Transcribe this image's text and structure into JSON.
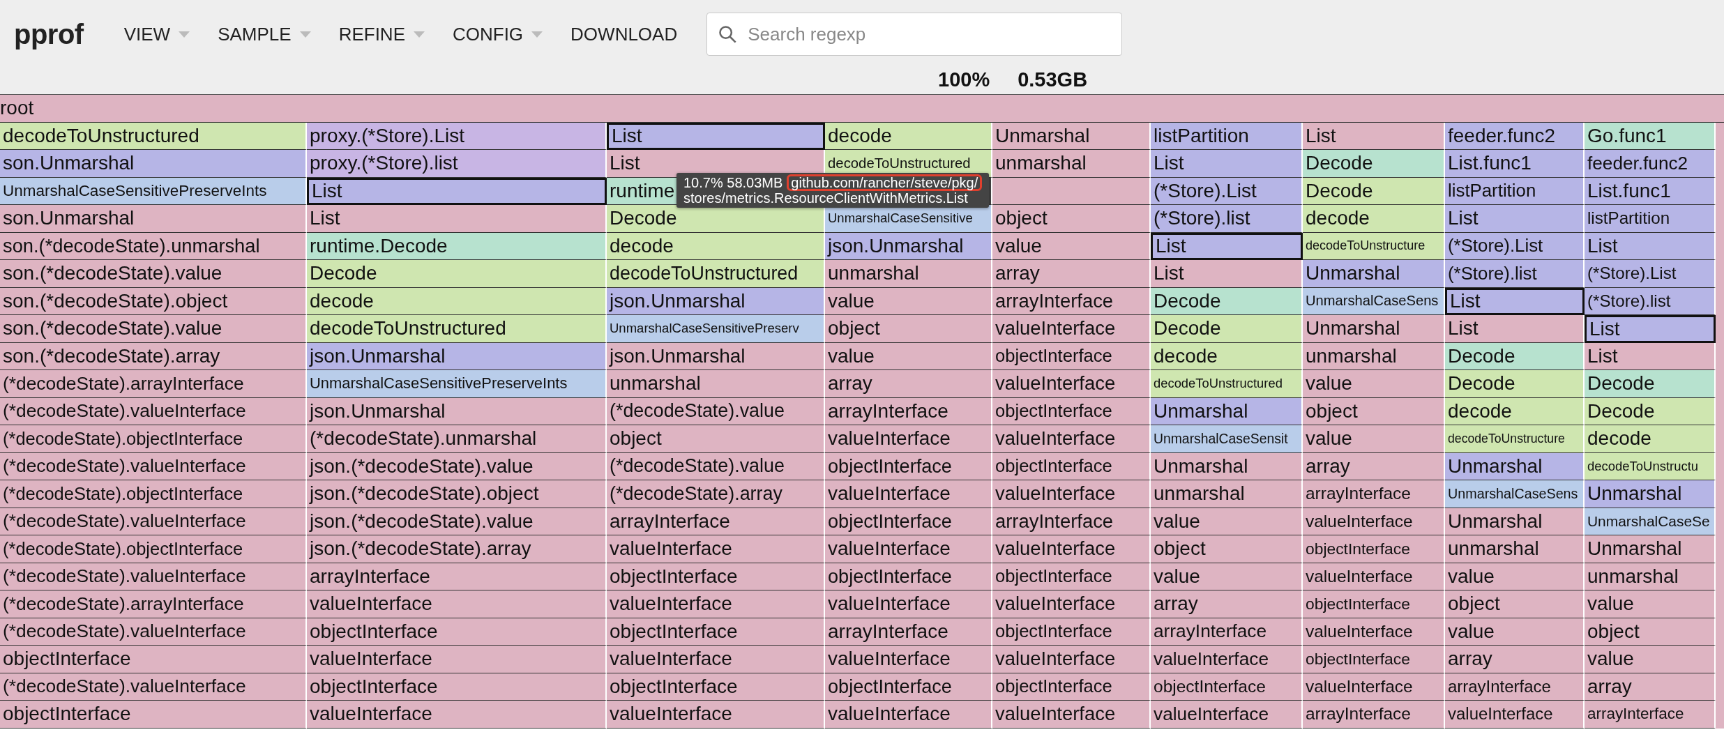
{
  "header": {
    "logo": "pprof",
    "menus": [
      {
        "label": "VIEW",
        "dropdown": true
      },
      {
        "label": "SAMPLE",
        "dropdown": true
      },
      {
        "label": "REFINE",
        "dropdown": true
      },
      {
        "label": "CONFIG",
        "dropdown": true
      },
      {
        "label": "DOWNLOAD",
        "dropdown": false
      }
    ],
    "search": {
      "placeholder": "Search regexp"
    },
    "stats": [
      "100%",
      "0.53GB"
    ]
  },
  "flame": {
    "root": {
      "name": "root",
      "color": "#deb4c2"
    },
    "columns": [
      {
        "frames": [
          {
            "name": "decodeToUnstructured",
            "color": "#cfe6b0",
            "highlighted": false
          },
          {
            "name": "son.Unmarshal",
            "color": "#b6b5e6",
            "highlighted": false
          },
          {
            "name": "UnmarshalCaseSensitivePreserveInts",
            "color": "#b9cdea",
            "highlighted": false
          },
          {
            "name": "son.Unmarshal",
            "color": "#deb4c2",
            "highlighted": false
          },
          {
            "name": "son.(*decodeState).unmarshal",
            "color": "#deb4c2",
            "highlighted": false
          },
          {
            "name": "son.(*decodeState).value",
            "color": "#deb4c2",
            "highlighted": false
          },
          {
            "name": "son.(*decodeState).object",
            "color": "#deb4c2",
            "highlighted": false
          },
          {
            "name": "son.(*decodeState).value",
            "color": "#deb4c2",
            "highlighted": false
          },
          {
            "name": "son.(*decodeState).array",
            "color": "#deb4c2",
            "highlighted": false
          },
          {
            "name": "(*decodeState).arrayInterface",
            "color": "#deb4c2",
            "highlighted": false
          },
          {
            "name": "(*decodeState).valueInterface",
            "color": "#deb4c2",
            "highlighted": false
          },
          {
            "name": "(*decodeState).objectInterface",
            "color": "#deb4c2",
            "highlighted": false
          },
          {
            "name": "(*decodeState).valueInterface",
            "color": "#deb4c2",
            "highlighted": false
          },
          {
            "name": "(*decodeState).objectInterface",
            "color": "#deb4c2",
            "highlighted": false
          },
          {
            "name": "(*decodeState).valueInterface",
            "color": "#deb4c2",
            "highlighted": false
          },
          {
            "name": "(*decodeState).objectInterface",
            "color": "#deb4c2",
            "highlighted": false
          },
          {
            "name": "(*decodeState).valueInterface",
            "color": "#deb4c2",
            "highlighted": false
          },
          {
            "name": "(*decodeState).arrayInterface",
            "color": "#deb4c2",
            "highlighted": false
          },
          {
            "name": "(*decodeState).valueInterface",
            "color": "#deb4c2",
            "highlighted": false
          },
          {
            "name": "objectInterface",
            "color": "#deb4c2",
            "highlighted": false
          },
          {
            "name": "(*decodeState).valueInterface",
            "color": "#deb4c2",
            "highlighted": false
          },
          {
            "name": "objectInterface",
            "color": "#deb4c2",
            "highlighted": false
          }
        ]
      },
      {
        "frames": [
          {
            "name": "proxy.(*Store).List",
            "color": "#c8b5e4",
            "highlighted": false
          },
          {
            "name": "proxy.(*Store).list",
            "color": "#c8b5e4",
            "highlighted": false
          },
          {
            "name": "List",
            "color": "#b6b5e6",
            "highlighted": true
          },
          {
            "name": "List",
            "color": "#deb4c2",
            "highlighted": false
          },
          {
            "name": "runtime.Decode",
            "color": "#b7e2cf",
            "highlighted": false
          },
          {
            "name": "Decode",
            "color": "#cfe6b0",
            "highlighted": false
          },
          {
            "name": "decode",
            "color": "#cfe6b0",
            "highlighted": false
          },
          {
            "name": "decodeToUnstructured",
            "color": "#cfe6b0",
            "highlighted": false
          },
          {
            "name": "json.Unmarshal",
            "color": "#b6b5e6",
            "highlighted": false
          },
          {
            "name": "UnmarshalCaseSensitivePreserveInts",
            "color": "#b9cdea",
            "highlighted": false
          },
          {
            "name": "json.Unmarshal",
            "color": "#deb4c2",
            "highlighted": false
          },
          {
            "name": "(*decodeState).unmarshal",
            "color": "#deb4c2",
            "highlighted": false
          },
          {
            "name": "json.(*decodeState).value",
            "color": "#deb4c2",
            "highlighted": false
          },
          {
            "name": "json.(*decodeState).object",
            "color": "#deb4c2",
            "highlighted": false
          },
          {
            "name": "json.(*decodeState).value",
            "color": "#deb4c2",
            "highlighted": false
          },
          {
            "name": "json.(*decodeState).array",
            "color": "#deb4c2",
            "highlighted": false
          },
          {
            "name": "arrayInterface",
            "color": "#deb4c2",
            "highlighted": false
          },
          {
            "name": "valueInterface",
            "color": "#deb4c2",
            "highlighted": false
          },
          {
            "name": "objectInterface",
            "color": "#deb4c2",
            "highlighted": false
          },
          {
            "name": "valueInterface",
            "color": "#deb4c2",
            "highlighted": false
          },
          {
            "name": "objectInterface",
            "color": "#deb4c2",
            "highlighted": false
          },
          {
            "name": "valueInterface",
            "color": "#deb4c2",
            "highlighted": false
          }
        ]
      },
      {
        "frames": [
          {
            "name": "List",
            "color": "#b6b5e6",
            "highlighted": true
          },
          {
            "name": "List",
            "color": "#deb4c2",
            "highlighted": false
          },
          {
            "name": "runtime",
            "color": "#b7e2cf",
            "highlighted": false
          },
          {
            "name": "Decode",
            "color": "#cfe6b0",
            "highlighted": false
          },
          {
            "name": "decode",
            "color": "#cfe6b0",
            "highlighted": false
          },
          {
            "name": "decodeToUnstructured",
            "color": "#cfe6b0",
            "highlighted": false
          },
          {
            "name": "json.Unmarshal",
            "color": "#b6b5e6",
            "highlighted": false
          },
          {
            "name": "UnmarshalCaseSensitivePreserv",
            "color": "#b9cdea",
            "highlighted": false
          },
          {
            "name": "json.Unmarshal",
            "color": "#deb4c2",
            "highlighted": false
          },
          {
            "name": "unmarshal",
            "color": "#deb4c2",
            "highlighted": false
          },
          {
            "name": "(*decodeState).value",
            "color": "#deb4c2",
            "highlighted": false
          },
          {
            "name": "object",
            "color": "#deb4c2",
            "highlighted": false
          },
          {
            "name": "(*decodeState).value",
            "color": "#deb4c2",
            "highlighted": false
          },
          {
            "name": "(*decodeState).array",
            "color": "#deb4c2",
            "highlighted": false
          },
          {
            "name": "arrayInterface",
            "color": "#deb4c2",
            "highlighted": false
          },
          {
            "name": "valueInterface",
            "color": "#deb4c2",
            "highlighted": false
          },
          {
            "name": "objectInterface",
            "color": "#deb4c2",
            "highlighted": false
          },
          {
            "name": "valueInterface",
            "color": "#deb4c2",
            "highlighted": false
          },
          {
            "name": "objectInterface",
            "color": "#deb4c2",
            "highlighted": false
          },
          {
            "name": "valueInterface",
            "color": "#deb4c2",
            "highlighted": false
          },
          {
            "name": "objectInterface",
            "color": "#deb4c2",
            "highlighted": false
          },
          {
            "name": "valueInterface",
            "color": "#deb4c2",
            "highlighted": false
          }
        ]
      },
      {
        "frames": [
          {
            "name": "decode",
            "color": "#cfe6b0",
            "highlighted": false
          },
          {
            "name": "decodeToUnstructured",
            "color": "#cfe6b0",
            "highlighted": false
          },
          {
            "kind": "covered"
          },
          {
            "name": "UnmarshalCaseSensitive",
            "color": "#b9cdea",
            "highlighted": false
          },
          {
            "name": "json.Unmarshal",
            "color": "#b6b5e6",
            "highlighted": false
          },
          {
            "name": "unmarshal",
            "color": "#deb4c2",
            "highlighted": false
          },
          {
            "name": "value",
            "color": "#deb4c2",
            "highlighted": false
          },
          {
            "name": "object",
            "color": "#deb4c2",
            "highlighted": false
          },
          {
            "name": "value",
            "color": "#deb4c2",
            "highlighted": false
          },
          {
            "name": "array",
            "color": "#deb4c2",
            "highlighted": false
          },
          {
            "name": "arrayInterface",
            "color": "#deb4c2",
            "highlighted": false
          },
          {
            "name": "valueInterface",
            "color": "#deb4c2",
            "highlighted": false
          },
          {
            "name": "objectInterface",
            "color": "#deb4c2",
            "highlighted": false
          },
          {
            "name": "valueInterface",
            "color": "#deb4c2",
            "highlighted": false
          },
          {
            "name": "objectInterface",
            "color": "#deb4c2",
            "highlighted": false
          },
          {
            "name": "valueInterface",
            "color": "#deb4c2",
            "highlighted": false
          },
          {
            "name": "objectInterface",
            "color": "#deb4c2",
            "highlighted": false
          },
          {
            "name": "valueInterface",
            "color": "#deb4c2",
            "highlighted": false
          },
          {
            "name": "arrayInterface",
            "color": "#deb4c2",
            "highlighted": false
          },
          {
            "name": "valueInterface",
            "color": "#deb4c2",
            "highlighted": false
          },
          {
            "name": "objectInterface",
            "color": "#deb4c2",
            "highlighted": false
          },
          {
            "name": "valueInterface",
            "color": "#deb4c2",
            "highlighted": false
          }
        ]
      },
      {
        "frames": [
          {
            "name": "Unmarshal",
            "color": "#deb4c2",
            "highlighted": false
          },
          {
            "name": "unmarshal",
            "color": "#deb4c2",
            "highlighted": false
          },
          {
            "color": "#deb4c2",
            "highlighted": false
          },
          {
            "name": "object",
            "color": "#deb4c2",
            "highlighted": false
          },
          {
            "name": "value",
            "color": "#deb4c2",
            "highlighted": false
          },
          {
            "name": "array",
            "color": "#deb4c2",
            "highlighted": false
          },
          {
            "name": "arrayInterface",
            "color": "#deb4c2",
            "highlighted": false
          },
          {
            "name": "valueInterface",
            "color": "#deb4c2",
            "highlighted": false
          },
          {
            "name": "objectInterface",
            "color": "#deb4c2",
            "highlighted": false
          },
          {
            "name": "valueInterface",
            "color": "#deb4c2",
            "highlighted": false
          },
          {
            "name": "objectInterface",
            "color": "#deb4c2",
            "highlighted": false
          },
          {
            "name": "valueInterface",
            "color": "#deb4c2",
            "highlighted": false
          },
          {
            "name": "objectInterface",
            "color": "#deb4c2",
            "highlighted": false
          },
          {
            "name": "valueInterface",
            "color": "#deb4c2",
            "highlighted": false
          },
          {
            "name": "arrayInterface",
            "color": "#deb4c2",
            "highlighted": false
          },
          {
            "name": "valueInterface",
            "color": "#deb4c2",
            "highlighted": false
          },
          {
            "name": "objectInterface",
            "color": "#deb4c2",
            "highlighted": false
          },
          {
            "name": "valueInterface",
            "color": "#deb4c2",
            "highlighted": false
          },
          {
            "name": "objectInterface",
            "color": "#deb4c2",
            "highlighted": false
          },
          {
            "name": "valueInterface",
            "color": "#deb4c2",
            "highlighted": false
          },
          {
            "name": "objectInterface",
            "color": "#deb4c2",
            "highlighted": false
          },
          {
            "name": "valueInterface",
            "color": "#deb4c2",
            "highlighted": false
          }
        ]
      },
      {
        "frames": [
          {
            "name": "listPartition",
            "color": "#b6b5e6",
            "highlighted": false
          },
          {
            "name": "List",
            "color": "#b6b5e6",
            "highlighted": false
          },
          {
            "name": "(*Store).List",
            "color": "#b6b5e6",
            "highlighted": false
          },
          {
            "name": "(*Store).list",
            "color": "#b6b5e6",
            "highlighted": false
          },
          {
            "name": "List",
            "color": "#b6b5e6",
            "highlighted": true
          },
          {
            "name": "List",
            "color": "#deb4c2",
            "highlighted": false
          },
          {
            "name": "Decode",
            "color": "#b7e2cf",
            "highlighted": false
          },
          {
            "name": "Decode",
            "color": "#cfe6b0",
            "highlighted": false
          },
          {
            "name": "decode",
            "color": "#cfe6b0",
            "highlighted": false
          },
          {
            "name": "decodeToUnstructured",
            "color": "#cfe6b0",
            "highlighted": false
          },
          {
            "name": "Unmarshal",
            "color": "#b6b5e6",
            "highlighted": false
          },
          {
            "name": "UnmarshalCaseSensit",
            "color": "#b9cdea",
            "highlighted": false
          },
          {
            "name": "Unmarshal",
            "color": "#deb4c2",
            "highlighted": false
          },
          {
            "name": "unmarshal",
            "color": "#deb4c2",
            "highlighted": false
          },
          {
            "name": "value",
            "color": "#deb4c2",
            "highlighted": false
          },
          {
            "name": "object",
            "color": "#deb4c2",
            "highlighted": false
          },
          {
            "name": "value",
            "color": "#deb4c2",
            "highlighted": false
          },
          {
            "name": "array",
            "color": "#deb4c2",
            "highlighted": false
          },
          {
            "name": "arrayInterface",
            "color": "#deb4c2",
            "highlighted": false
          },
          {
            "name": "valueInterface",
            "color": "#deb4c2",
            "highlighted": false
          },
          {
            "name": "objectInterface",
            "color": "#deb4c2",
            "highlighted": false
          },
          {
            "name": "valueInterface",
            "color": "#deb4c2",
            "highlighted": false
          }
        ]
      },
      {
        "frames": [
          {
            "name": "List",
            "color": "#deb4c2",
            "highlighted": false
          },
          {
            "name": "Decode",
            "color": "#b7e2cf",
            "highlighted": false
          },
          {
            "name": "Decode",
            "color": "#cfe6b0",
            "highlighted": false
          },
          {
            "name": "decode",
            "color": "#cfe6b0",
            "highlighted": false
          },
          {
            "name": "decodeToUnstructure",
            "color": "#cfe6b0",
            "highlighted": false
          },
          {
            "name": "Unmarshal",
            "color": "#b6b5e6",
            "highlighted": false
          },
          {
            "name": "UnmarshalCaseSens",
            "color": "#b9cdea",
            "highlighted": false
          },
          {
            "name": "Unmarshal",
            "color": "#deb4c2",
            "highlighted": false
          },
          {
            "name": "unmarshal",
            "color": "#deb4c2",
            "highlighted": false
          },
          {
            "name": "value",
            "color": "#deb4c2",
            "highlighted": false
          },
          {
            "name": "object",
            "color": "#deb4c2",
            "highlighted": false
          },
          {
            "name": "value",
            "color": "#deb4c2",
            "highlighted": false
          },
          {
            "name": "array",
            "color": "#deb4c2",
            "highlighted": false
          },
          {
            "name": "arrayInterface",
            "color": "#deb4c2",
            "highlighted": false
          },
          {
            "name": "valueInterface",
            "color": "#deb4c2",
            "highlighted": false
          },
          {
            "name": "objectInterface",
            "color": "#deb4c2",
            "highlighted": false
          },
          {
            "name": "valueInterface",
            "color": "#deb4c2",
            "highlighted": false
          },
          {
            "name": "objectInterface",
            "color": "#deb4c2",
            "highlighted": false
          },
          {
            "name": "valueInterface",
            "color": "#deb4c2",
            "highlighted": false
          },
          {
            "name": "objectInterface",
            "color": "#deb4c2",
            "highlighted": false
          },
          {
            "name": "valueInterface",
            "color": "#deb4c2",
            "highlighted": false
          },
          {
            "name": "arrayInterface",
            "color": "#deb4c2",
            "highlighted": false
          }
        ]
      },
      {
        "frames": [
          {
            "name": "feeder.func2",
            "color": "#b6b5e6",
            "highlighted": false
          },
          {
            "name": "List.func1",
            "color": "#b6b5e6",
            "highlighted": false
          },
          {
            "name": "listPartition",
            "color": "#b6b5e6",
            "highlighted": false
          },
          {
            "name": "List",
            "color": "#b6b5e6",
            "highlighted": false
          },
          {
            "name": "(*Store).List",
            "color": "#b6b5e6",
            "highlighted": false
          },
          {
            "name": "(*Store).list",
            "color": "#b6b5e6",
            "highlighted": false
          },
          {
            "name": "List",
            "color": "#b6b5e6",
            "highlighted": true
          },
          {
            "name": "List",
            "color": "#deb4c2",
            "highlighted": false
          },
          {
            "name": "Decode",
            "color": "#b7e2cf",
            "highlighted": false
          },
          {
            "name": "Decode",
            "color": "#cfe6b0",
            "highlighted": false
          },
          {
            "name": "decode",
            "color": "#cfe6b0",
            "highlighted": false
          },
          {
            "name": "decodeToUnstructure",
            "color": "#cfe6b0",
            "highlighted": false
          },
          {
            "name": "Unmarshal",
            "color": "#b6b5e6",
            "highlighted": false
          },
          {
            "name": "UnmarshalCaseSens",
            "color": "#b9cdea",
            "highlighted": false
          },
          {
            "name": "Unmarshal",
            "color": "#deb4c2",
            "highlighted": false
          },
          {
            "name": "unmarshal",
            "color": "#deb4c2",
            "highlighted": false
          },
          {
            "name": "value",
            "color": "#deb4c2",
            "highlighted": false
          },
          {
            "name": "object",
            "color": "#deb4c2",
            "highlighted": false
          },
          {
            "name": "value",
            "color": "#deb4c2",
            "highlighted": false
          },
          {
            "name": "array",
            "color": "#deb4c2",
            "highlighted": false
          },
          {
            "name": "arrayInterface",
            "color": "#deb4c2",
            "highlighted": false
          },
          {
            "name": "valueInterface",
            "color": "#deb4c2",
            "highlighted": false
          }
        ]
      },
      {
        "frames": [
          {
            "name": "Go.func1",
            "color": "#b7e2cf",
            "highlighted": false
          },
          {
            "name": "feeder.func2",
            "color": "#b6b5e6",
            "highlighted": false
          },
          {
            "name": "List.func1",
            "color": "#b6b5e6",
            "highlighted": false
          },
          {
            "name": "listPartition",
            "color": "#b6b5e6",
            "highlighted": false
          },
          {
            "name": "List",
            "color": "#b6b5e6",
            "highlighted": false
          },
          {
            "name": "(*Store).List",
            "color": "#b6b5e6",
            "highlighted": false
          },
          {
            "name": "(*Store).list",
            "color": "#b6b5e6",
            "highlighted": false
          },
          {
            "name": "List",
            "color": "#b6b5e6",
            "highlighted": true
          },
          {
            "name": "List",
            "color": "#deb4c2",
            "highlighted": false
          },
          {
            "name": "Decode",
            "color": "#b7e2cf",
            "highlighted": false
          },
          {
            "name": "Decode",
            "color": "#cfe6b0",
            "highlighted": false
          },
          {
            "name": "decode",
            "color": "#cfe6b0",
            "highlighted": false
          },
          {
            "name": "decodeToUnstructu",
            "color": "#cfe6b0",
            "highlighted": false
          },
          {
            "name": "Unmarshal",
            "color": "#b6b5e6",
            "highlighted": false
          },
          {
            "name": "UnmarshalCaseSe",
            "color": "#b9cdea",
            "highlighted": false
          },
          {
            "name": "Unmarshal",
            "color": "#deb4c2",
            "highlighted": false
          },
          {
            "name": "unmarshal",
            "color": "#deb4c2",
            "highlighted": false
          },
          {
            "name": "value",
            "color": "#deb4c2",
            "highlighted": false
          },
          {
            "name": "object",
            "color": "#deb4c2",
            "highlighted": false
          },
          {
            "name": "value",
            "color": "#deb4c2",
            "highlighted": false
          },
          {
            "name": "array",
            "color": "#deb4c2",
            "highlighted": false
          },
          {
            "name": "arrayInterface",
            "color": "#deb4c2",
            "highlighted": false
          }
        ]
      }
    ]
  },
  "tooltip": {
    "stats": "10.7% 58.03MB",
    "path": "github.com/rancher/steve/pkg/",
    "function": "stores/metrics.ResourceClientWithMetrics.List"
  }
}
